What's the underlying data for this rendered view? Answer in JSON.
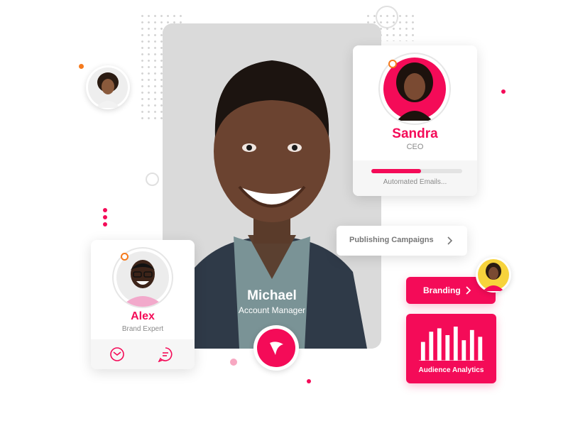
{
  "colors": {
    "accent": "#f40b58",
    "orange": "#f57a1d",
    "text_gray": "#8a8a8a",
    "photo_bg": "#d9d9d9"
  },
  "main_profile": {
    "name": "Michael",
    "role": "Account Manager",
    "play_icon": "play-logo-icon"
  },
  "sandra_card": {
    "name": "Sandra",
    "role": "CEO",
    "status_label": "Automated Emails...",
    "progress": 0.55
  },
  "alex_card": {
    "name": "Alex",
    "role": "Brand Expert",
    "actions": [
      "mail-icon",
      "chat-icon"
    ]
  },
  "publishing": {
    "label": "Publishing Campaigns",
    "icon": "chevron-right-icon"
  },
  "branding": {
    "label": "Branding",
    "icon": "chevron-right-icon"
  },
  "analytics": {
    "label": "Audience Analytics",
    "bars": [
      0.55,
      0.85,
      0.95,
      0.75,
      1.0,
      0.6,
      0.9,
      0.7
    ]
  }
}
